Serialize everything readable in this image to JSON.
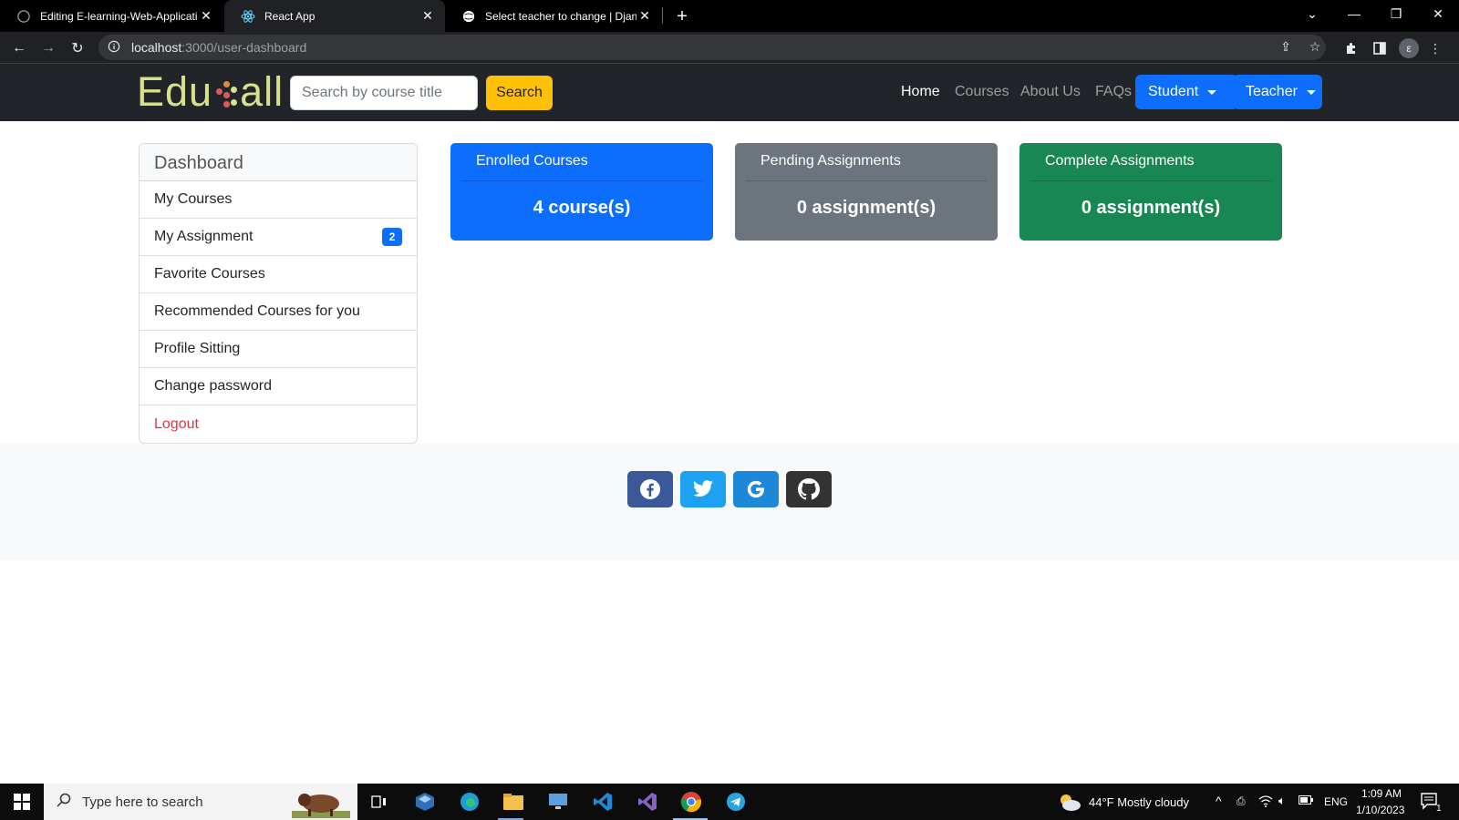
{
  "browser": {
    "tabs": [
      {
        "title": "Editing E-learning-Web-Applicati",
        "active": false
      },
      {
        "title": "React App",
        "active": true
      },
      {
        "title": "Select teacher to change | Djang",
        "active": false
      }
    ],
    "url_host": "localhost",
    "url_path": ":3000/user-dashboard",
    "profile_initial": "ε"
  },
  "navbar": {
    "brand_left": "Edu",
    "brand_right": "all",
    "search_placeholder": "Search by course title",
    "search_button": "Search",
    "links": [
      "Home",
      "Courses",
      "About Us",
      "FAQs"
    ],
    "student_dropdown": "Student",
    "teacher_dropdown": "Teacher"
  },
  "sidebar": {
    "header": "Dashboard",
    "items": [
      {
        "label": "My Courses"
      },
      {
        "label": "My Assignment",
        "badge": "2"
      },
      {
        "label": "Favorite Courses"
      },
      {
        "label": "Recommended Courses for you"
      },
      {
        "label": "Profile Sitting"
      },
      {
        "label": "Change password"
      },
      {
        "label": "Logout"
      }
    ]
  },
  "cards": [
    {
      "title": "Enrolled Courses",
      "value": "4 course(s)",
      "color": "#0d6efd"
    },
    {
      "title": "Pending Assignments",
      "value": "0 assignment(s)",
      "color": "#6c757d"
    },
    {
      "title": "Complete Assignments",
      "value": "0 assignment(s)",
      "color": "#198754"
    }
  ],
  "footer": {
    "social": [
      "facebook-icon",
      "twitter-icon",
      "google-icon",
      "github-icon"
    ]
  },
  "taskbar": {
    "search_placeholder": "Type here to search",
    "weather": "44°F  Mostly cloudy",
    "language": "ENG",
    "time": "1:09 AM",
    "date": "1/10/2023",
    "notification_count": "1"
  }
}
